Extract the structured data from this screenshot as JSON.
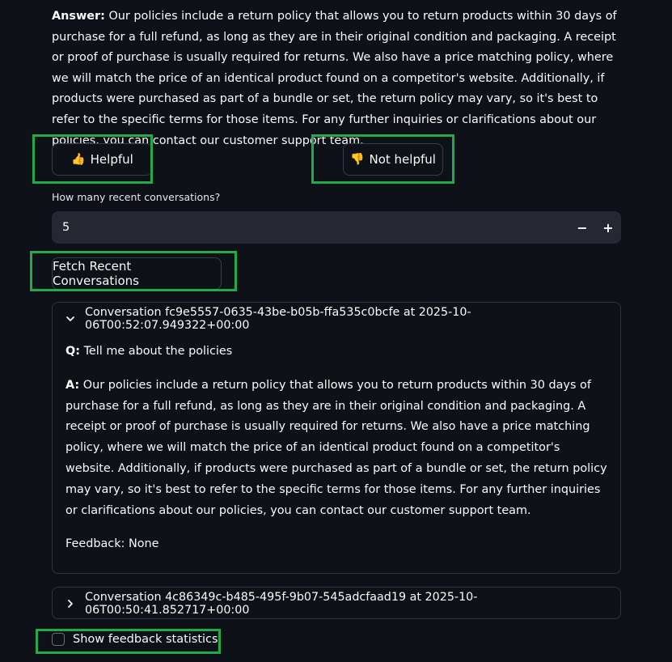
{
  "answer": {
    "label": "Answer:",
    "text": "Our policies include a return policy that allows you to return products within 30 days of purchase for a full refund, as long as they are in their original condition and packaging. A receipt or proof of purchase is usually required for returns. We also have a price matching policy, where we will match the price of an identical product found on a competitor's website. Additionally, if products were purchased as part of a bundle or set, the return policy may vary, so it's best to refer to the specific terms for those items. For any further inquiries or clarifications about our policies, you can contact our customer support team."
  },
  "feedback": {
    "helpful_icon": "👍",
    "helpful_label": "Helpful",
    "not_helpful_icon": "👎",
    "not_helpful_label": "Not helpful"
  },
  "recent": {
    "label": "How many recent conversations?",
    "value": "5",
    "minus": "−",
    "plus": "+",
    "fetch_label": "Fetch Recent Conversations"
  },
  "conversations": [
    {
      "title": "Conversation fc9e5557-0635-43be-b05b-ffa535c0bcfe at 2025-10-06T00:52:07.949322+00:00",
      "expanded": true,
      "q_label": "Q:",
      "question": "Tell me about the policies",
      "a_label": "A:",
      "answer": "Our policies include a return policy that allows you to return products within 30 days of purchase for a full refund, as long as they are in their original condition and packaging. A receipt or proof of purchase is usually required for returns. We also have a price matching policy, where we will match the price of an identical product found on a competitor's website. Additionally, if products were purchased as part of a bundle or set, the return policy may vary, so it's best to refer to the specific terms for those items. For any further inquiries or clarifications about our policies, you can contact our customer support team.",
      "feedback": "Feedback: None"
    },
    {
      "title": "Conversation 4c86349c-b485-495f-9b07-545adcfaad19 at 2025-10-06T00:50:41.852717+00:00",
      "expanded": false
    }
  ],
  "stats": {
    "checkbox_label": "Show feedback statistics",
    "checked": false
  },
  "colors": {
    "highlight": "#22a94b",
    "background": "#0e1117",
    "input_bg": "#262730"
  },
  "icons": {
    "expand": "chevron-down-icon",
    "collapse": "chevron-right-icon"
  }
}
